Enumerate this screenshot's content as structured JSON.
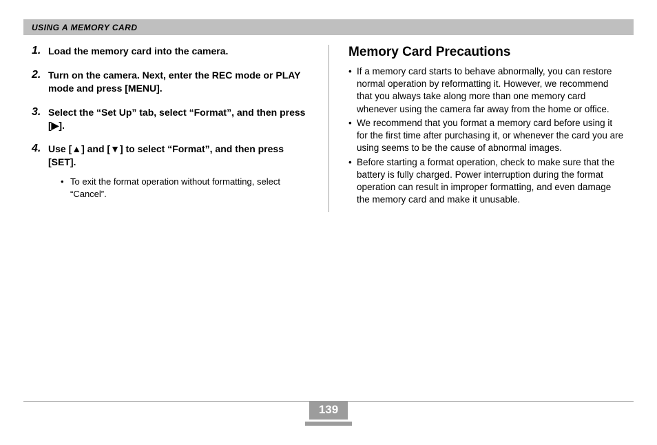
{
  "header": {
    "title": "USING A MEMORY CARD"
  },
  "left": {
    "steps": [
      {
        "num": "1.",
        "text": "Load the memory card into the camera."
      },
      {
        "num": "2.",
        "text": "Turn on the camera. Next, enter the REC mode or PLAY mode and press [MENU]."
      },
      {
        "num": "3.",
        "text": "Select the “Set Up” tab, select “Format”, and then press [▶]."
      },
      {
        "num": "4.",
        "text": "Use [▲] and [▼] to select “Format”, and then press [SET].",
        "sub": [
          "To exit the format operation without formatting, select “Cancel”."
        ]
      }
    ]
  },
  "right": {
    "title": "Memory Card Precautions",
    "items": [
      "If a memory card starts to behave abnormally, you can restore normal operation by reformatting it. However, we recommend that you always take along more than one memory card whenever using the camera far away from the home or office.",
      "We recommend that you format a memory card before using it for the first time after purchasing it, or whenever the card you are using seems to be the cause of abnormal images.",
      "Before starting a format operation, check to make sure that the battery is fully charged. Power interruption during the format operation can result in improper formatting, and even damage the memory card and make it unusable."
    ]
  },
  "footer": {
    "page_number": "139"
  }
}
